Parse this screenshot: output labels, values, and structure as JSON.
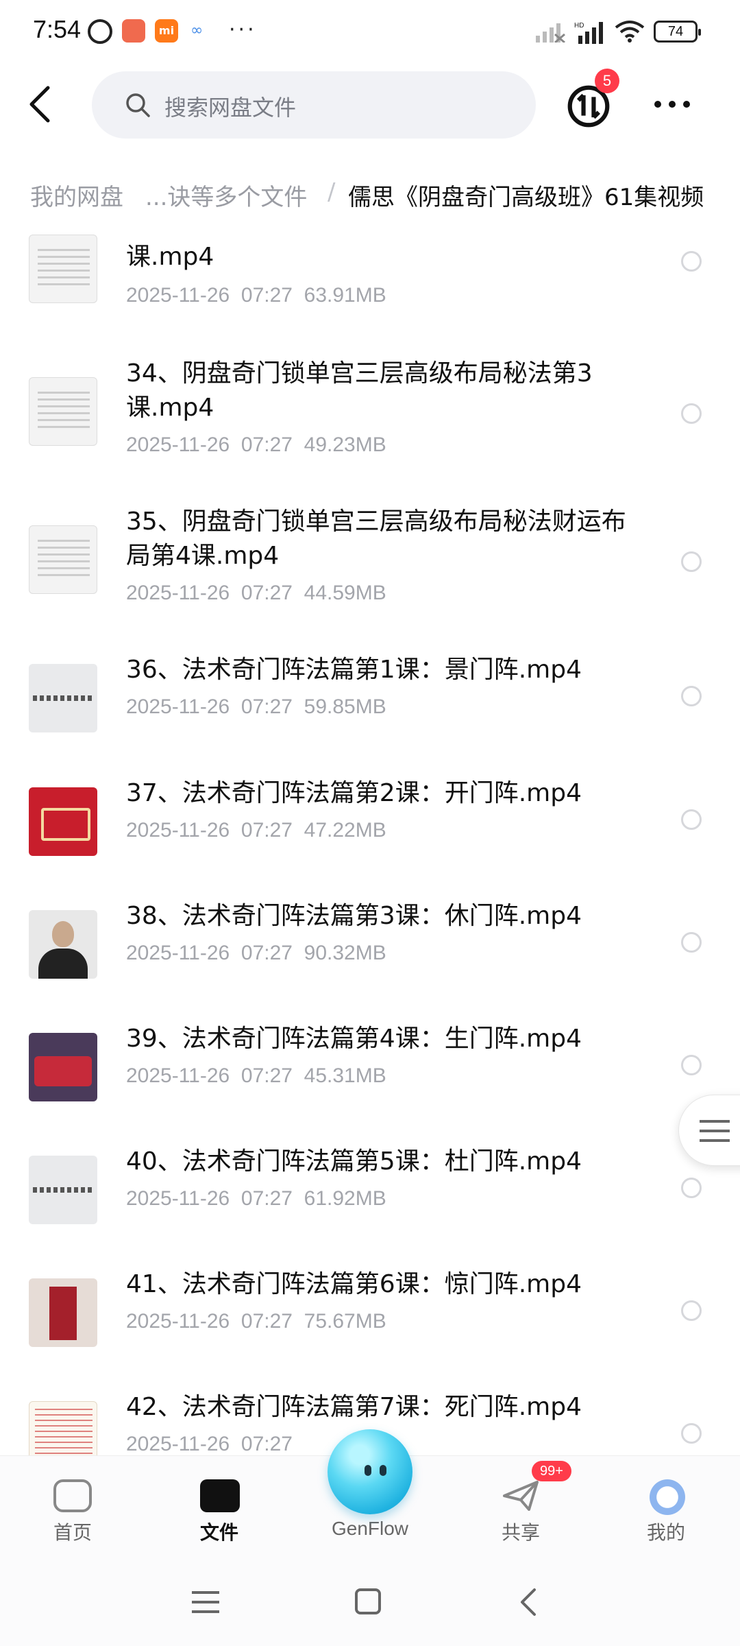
{
  "status_bar": {
    "time": "7:54",
    "network_label": "HD",
    "battery": "74"
  },
  "header": {
    "search_placeholder": "搜索网盘文件",
    "transfer_badge": "5"
  },
  "breadcrumb": {
    "root": "我的网盘",
    "middle": "...诀等多个文件",
    "separator": "/",
    "current": "儒思《阴盘奇门高级班》61集视频"
  },
  "files": [
    {
      "name": "课.mp4",
      "date": "2025-11-26",
      "time": "07:27",
      "size": "63.91MB",
      "thumb": "doc"
    },
    {
      "name": "34、阴盘奇门锁单宫三层高级布局秘法第3课.mp4",
      "date": "2025-11-26",
      "time": "07:27",
      "size": "49.23MB",
      "thumb": "doc"
    },
    {
      "name": "35、阴盘奇门锁单宫三层高级布局秘法财运布局第4课.mp4",
      "date": "2025-11-26",
      "time": "07:27",
      "size": "44.59MB",
      "thumb": "doc"
    },
    {
      "name": "36、法术奇门阵法篇第1课：景门阵.mp4",
      "date": "2025-11-26",
      "time": "07:27",
      "size": "59.85MB",
      "thumb": "gray"
    },
    {
      "name": "37、法术奇门阵法篇第2课：开门阵.mp4",
      "date": "2025-11-26",
      "time": "07:27",
      "size": "47.22MB",
      "thumb": "red"
    },
    {
      "name": "38、法术奇门阵法篇第3课：休门阵.mp4",
      "date": "2025-11-26",
      "time": "07:27",
      "size": "90.32MB",
      "thumb": "person"
    },
    {
      "name": "39、法术奇门阵法篇第4课：生门阵.mp4",
      "date": "2025-11-26",
      "time": "07:27",
      "size": "45.31MB",
      "thumb": "stage"
    },
    {
      "name": "40、法术奇门阵法篇第5课：杜门阵.mp4",
      "date": "2025-11-26",
      "time": "07:27",
      "size": "61.92MB",
      "thumb": "gray"
    },
    {
      "name": "41、法术奇门阵法篇第6课：惊门阵.mp4",
      "date": "2025-11-26",
      "time": "07:27",
      "size": "75.67MB",
      "thumb": "scroll"
    },
    {
      "name": "42、法术奇门阵法篇第7课：死门阵.mp4",
      "date": "2025-11-26",
      "time": "07:27",
      "size": "",
      "thumb": "text"
    }
  ],
  "bottom_nav": {
    "home": "首页",
    "files": "文件",
    "genflow": "GenFlow",
    "share": "共享",
    "share_badge": "99+",
    "me": "我的"
  },
  "icons": {
    "back": "back-arrow-icon",
    "search": "search-icon",
    "transfer": "transfer-icon",
    "more": "more-icon",
    "side_handle": "menu-icon"
  },
  "colors": {
    "badge": "#ff3b4a",
    "meta_text": "#a3a5ab",
    "search_bg": "#f1f2f6"
  }
}
